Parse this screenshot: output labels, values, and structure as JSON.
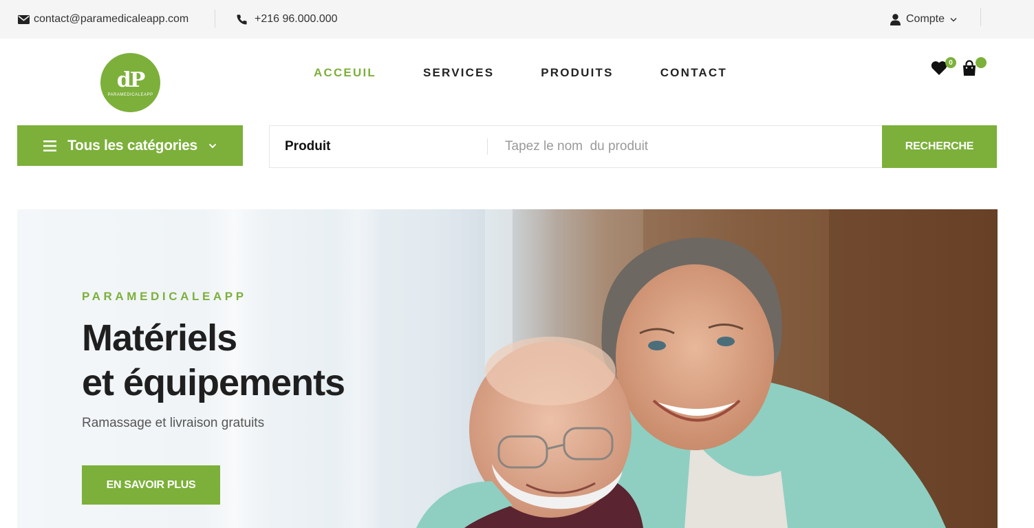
{
  "topbar": {
    "email": "contact@paramedicaleapp.com",
    "phone": "+216 96.000.000",
    "account_label": "Compte",
    "icons": {
      "email": "envelope-icon",
      "phone": "phone-icon",
      "account": "user-icon",
      "dropdown": "chevron-down-icon"
    }
  },
  "header": {
    "logo_mark": "dP",
    "logo_name": "PARAMEDICALEAPP",
    "nav": [
      {
        "label": "ACCEUIL",
        "active": true
      },
      {
        "label": "SERVICES",
        "active": false
      },
      {
        "label": "PRODUITS",
        "active": false
      },
      {
        "label": "CONTACT",
        "active": false
      }
    ],
    "wishlist_count": "0",
    "cart_count": "",
    "icons": {
      "wishlist": "heart-icon",
      "cart": "shopping-bag-icon"
    }
  },
  "categories": {
    "label": "Tous les catégories",
    "icons": {
      "menu": "hamburger-icon",
      "dropdown": "chevron-down-icon"
    }
  },
  "search": {
    "category": "Produit",
    "placeholder": "Tapez le nom  du produit",
    "value": "",
    "button_label": "RECHERCHE"
  },
  "hero": {
    "subtitle": "PARAMEDICALEAPP",
    "title_line1": "Matériels",
    "title_line2": "et équipements",
    "description": "Ramassage et livraison gratuits",
    "cta_label": "EN SAVOIR PLUS"
  },
  "colors": {
    "accent": "#7cb03a",
    "topbar_bg": "#f5f5f5",
    "text_dark": "#1f1f1f"
  }
}
